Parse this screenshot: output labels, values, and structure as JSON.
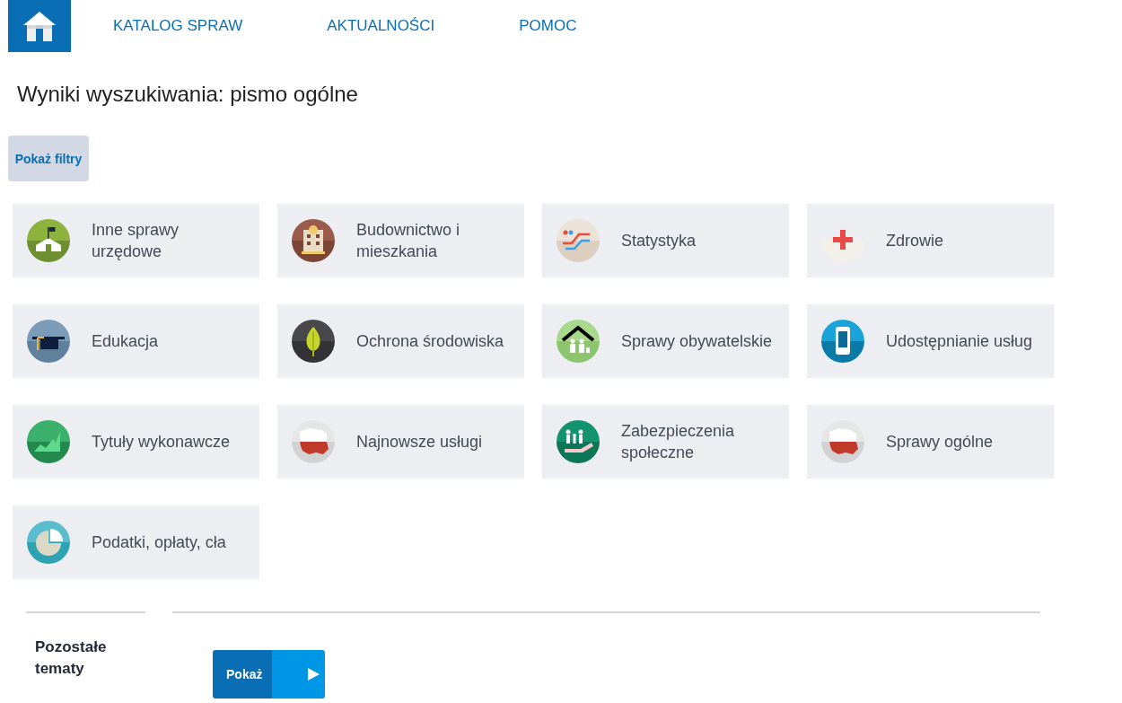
{
  "nav": [
    {
      "label": "KATALOG SPRAW"
    },
    {
      "label": "AKTUALNOŚCI"
    },
    {
      "label": "POMOC"
    }
  ],
  "title": "Wyniki wyszukiwania: pismo ogólne",
  "filter_button": "Pokaż filtry",
  "tiles": [
    {
      "label": "Inne sprawy urzędowe"
    },
    {
      "label": "Budownictwo i mieszkania"
    },
    {
      "label": "Statystyka"
    },
    {
      "label": "Zdrowie"
    },
    {
      "label": "Edukacja"
    },
    {
      "label": "Ochrona środowiska"
    },
    {
      "label": "Sprawy obywatelskie"
    },
    {
      "label": "Udostępnianie usług"
    },
    {
      "label": "Tytuły wykonawcze"
    },
    {
      "label": "Najnowsze usługi"
    },
    {
      "label": "Zabezpieczenia społeczne"
    },
    {
      "label": "Sprawy ogólne"
    },
    {
      "label": "Podatki, opłaty, cła"
    }
  ],
  "other_topics": {
    "label": "Pozostałe tematy",
    "button": "Pokaż"
  }
}
